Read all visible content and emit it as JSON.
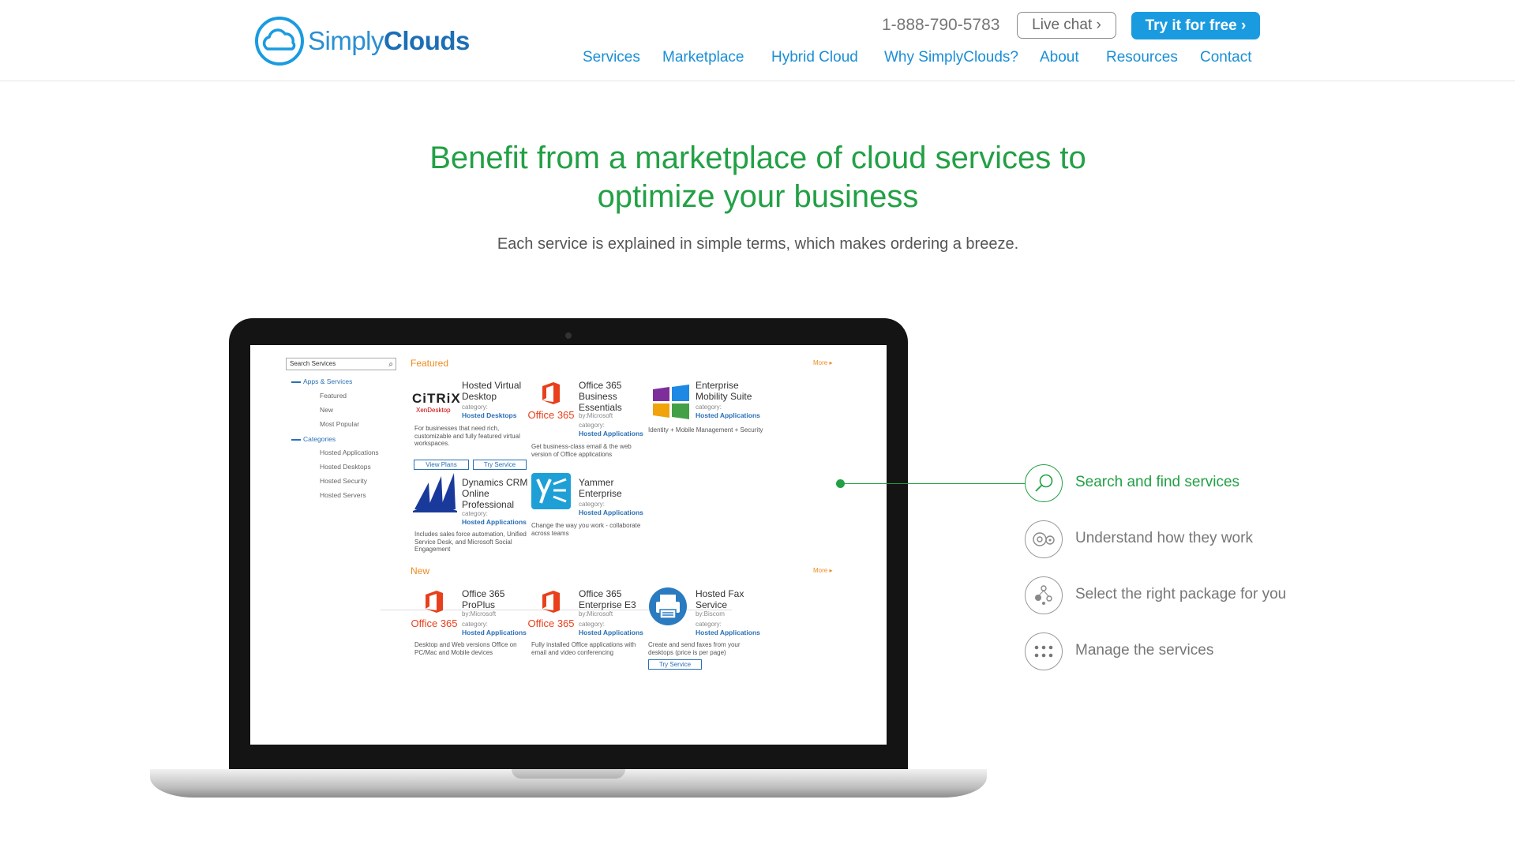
{
  "brand": {
    "logo_light": "Simply",
    "logo_bold": "Clouds"
  },
  "header": {
    "phone": "1-888-790-5783",
    "live_chat": "Live chat",
    "try_free": "Try it for free",
    "nav": [
      "Services",
      "Marketplace",
      "Hybrid Cloud",
      "Why SimplyClouds?",
      "About",
      "Resources",
      "Contact"
    ]
  },
  "hero": {
    "title_line1": "Benefit from a marketplace of cloud services to",
    "title_line2": "optimize your business",
    "subtitle": "Each service is explained in simple terms, which makes ordering a breeze."
  },
  "screen": {
    "search_placeholder": "Search Services",
    "sidebar": {
      "apps_header": "Apps & Services",
      "apps_items": [
        "Featured",
        "New",
        "Most Popular"
      ],
      "categories_header": "Categories",
      "category_items": [
        "Hosted Applications",
        "Hosted Desktops",
        "Hosted Security",
        "Hosted Servers"
      ]
    },
    "featured_title": "Featured",
    "new_title": "New",
    "more": "More ▸",
    "category_label": "category:",
    "by_microsoft": "by:Microsoft",
    "by_biscom": "by:Biscom",
    "office_logo": "Office 365",
    "citrix_logo": "CiTRiX",
    "citrix_sub": "XenDesktop",
    "cards": {
      "hvd": {
        "title": "Hosted Virtual Desktop",
        "category": "Hosted Desktops",
        "desc": "For businesses that need rich, customizable and fully featured virtual workspaces.",
        "btn1": "View Plans",
        "btn2": "Try Service"
      },
      "o365be": {
        "title": "Office 365 Business Essentials",
        "category": "Hosted Applications",
        "desc": "Get business-class email & the web version of Office applications"
      },
      "ems": {
        "title": "Enterprise Mobility Suite",
        "category": "Hosted Applications",
        "desc": "Identity + Mobile Management + Security"
      },
      "crm": {
        "title": "Dynamics CRM Online Professional",
        "category": "Hosted Applications",
        "desc": "Includes sales force automation, Unified Service Desk, and Microsoft Social Engagement"
      },
      "yammer": {
        "title": "Yammer Enterprise",
        "category": "Hosted Applications",
        "desc": "Change the way you work - collaborate across teams"
      },
      "proplus": {
        "title": "Office 365 ProPlus",
        "category": "Hosted Applications",
        "desc": "Desktop and Web versions Office on PC/Mac and Mobile devices"
      },
      "e3": {
        "title": "Office 365 Enterprise E3",
        "category": "Hosted Applications",
        "desc": "Fully installed Office applications with email and video conferencing"
      },
      "fax": {
        "title": "Hosted Fax Service",
        "category": "Hosted Applications",
        "desc": "Create and send faxes from your desktops (price is per page)",
        "btn": "Try Service"
      }
    }
  },
  "features": [
    {
      "label": "Search and find services",
      "icon": "search-icon",
      "active": true
    },
    {
      "label": "Understand how they work",
      "icon": "gears-icon",
      "active": false
    },
    {
      "label": "Select the right package for you",
      "icon": "package-icon",
      "active": false
    },
    {
      "label": "Manage the services",
      "icon": "dots-grid-icon",
      "active": false
    }
  ],
  "colors": {
    "accent_green": "#22a045",
    "brand_blue": "#1a9be0",
    "link_blue": "#1a8fd6",
    "orange": "#f08a1e",
    "office_red": "#e8401c"
  }
}
